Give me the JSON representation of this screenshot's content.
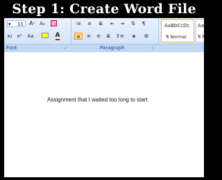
{
  "caption": "Step 1: Create Word File",
  "ribbon": {
    "font_size": "11",
    "font_group": "Font",
    "paragraph_group": "Paragraph",
    "style_preview": "AaBbCcDc",
    "style_preview2": "AaBb",
    "style_normal": "¶ Normal",
    "style_nospacing": "¶ No",
    "format_x2": "x₂",
    "format_sup": "x²",
    "format_aa": "Aa",
    "grow_font": "A",
    "shrink_font": "A",
    "pilcrow": "¶"
  },
  "document": {
    "text": "Assignment that I waited too long to start"
  },
  "colors": {
    "ribbon_bg": "#dbe8f8",
    "group_label": "#15428b",
    "highlight": "#ffff00",
    "font_color": "#ff0000",
    "selected_style_border": "#e6b85a"
  }
}
